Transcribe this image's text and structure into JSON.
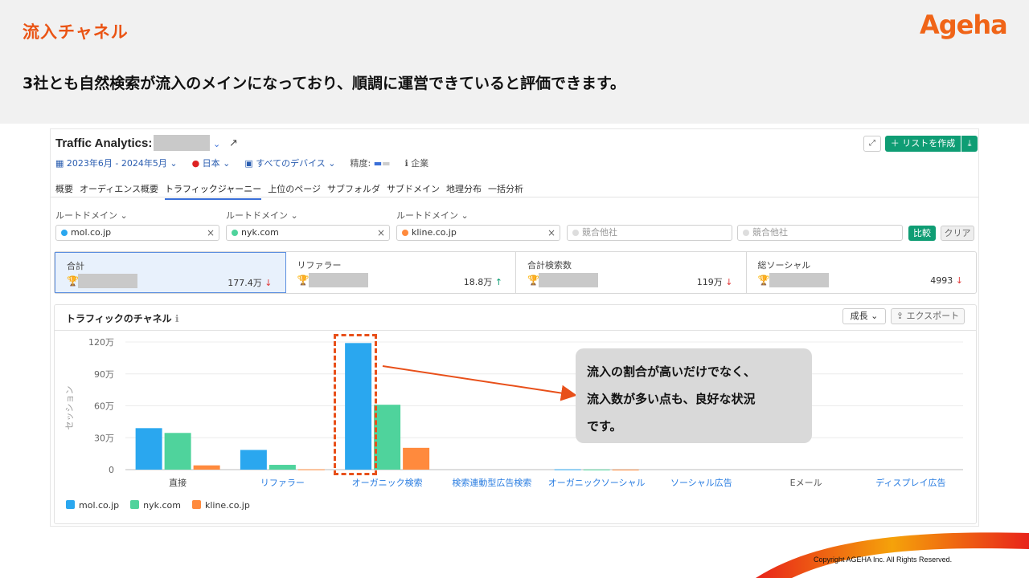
{
  "slide": {
    "title": "流入チャネル",
    "logo": "Ageha",
    "subtitle": "3社とも自然検索が流入のメインになっており、順調に運営できていると評価できます。",
    "copyright": "Copyright AGEHA Inc. All Rights Reserved."
  },
  "app": {
    "title": "Traffic Analytics:",
    "list_button": "＋ リストを作成",
    "filters": {
      "date_range": "2023年6月 - 2024年5月",
      "country": "日本",
      "device": "すべてのデバイス",
      "precision_label": "精度:",
      "company_label": "企業"
    },
    "tabs": [
      "概要",
      "オーディエンス概要",
      "トラフィックジャーニー",
      "上位のページ",
      "サブフォルダ",
      "サブドメイン",
      "地理分布",
      "一括分析"
    ],
    "root_domain_label": "ルートドメイン",
    "domains": [
      {
        "name": "mol.co.jp",
        "color": "#2aa7ef"
      },
      {
        "name": "nyk.com",
        "color": "#4fd39c"
      },
      {
        "name": "kline.co.jp",
        "color": "#ff8a3d"
      }
    ],
    "competitor_placeholder": "競合他社",
    "compare_button": "比較",
    "clear_button": "クリア",
    "metrics": [
      {
        "label": "合計",
        "value": "177.4万",
        "trend": "↓"
      },
      {
        "label": "リファラー",
        "value": "18.8万",
        "trend": "↑"
      },
      {
        "label": "合計検索数",
        "value": "119万",
        "trend": "↓"
      },
      {
        "label": "総ソーシャル",
        "value": "4993",
        "trend": "↓"
      }
    ],
    "panel": {
      "title": "トラフィックのチャネル",
      "grow_select": "成長",
      "export_button": "エクスポート"
    }
  },
  "chart_data": {
    "type": "bar",
    "ylabel": "セッション",
    "yticks": [
      "0",
      "30万",
      "60万",
      "90万",
      "120万"
    ],
    "ylim": [
      0,
      1300000
    ],
    "categories": [
      "直接",
      "リファラー",
      "オーガニック検索",
      "検索連動型広告検索",
      "オーガニックソーシャル",
      "ソーシャル広告",
      "Eメール",
      "ディスプレイ広告"
    ],
    "series": [
      {
        "name": "mol.co.jp",
        "color": "#2aa7ef",
        "values": [
          390000,
          185000,
          1190000,
          0,
          3000,
          0,
          0,
          0
        ]
      },
      {
        "name": "nyk.com",
        "color": "#4fd39c",
        "values": [
          345000,
          45000,
          610000,
          0,
          1500,
          0,
          0,
          0
        ]
      },
      {
        "name": "kline.co.jp",
        "color": "#ff8a3d",
        "values": [
          40000,
          3000,
          205000,
          0,
          500,
          0,
          0,
          0
        ]
      }
    ]
  },
  "callout": {
    "lines": [
      "流入の割合が高いだけでなく、",
      "流入数が多い点も、良好な状況",
      "です。"
    ]
  }
}
